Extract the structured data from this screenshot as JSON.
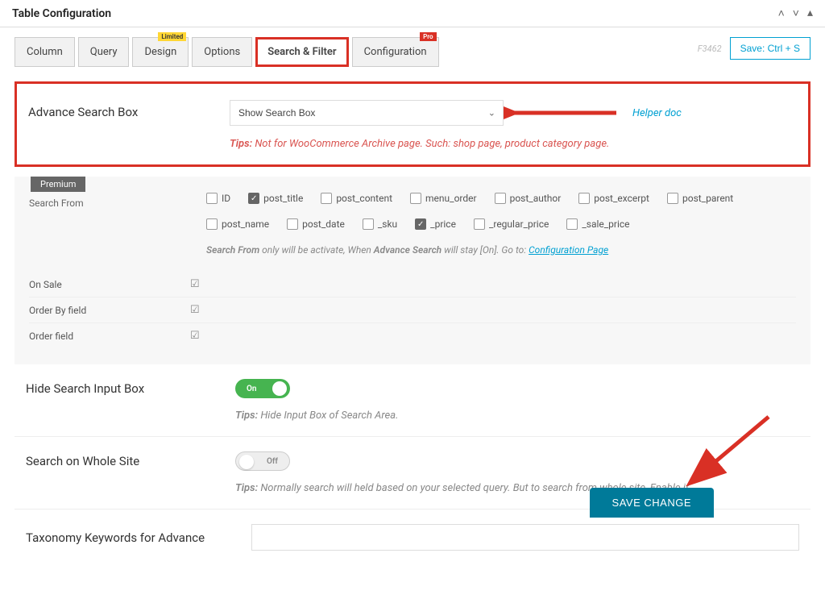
{
  "header": {
    "title": "Table Configuration"
  },
  "topbar": {
    "form_id": "F3462",
    "save_label": "Save: Ctrl + S"
  },
  "tabs": {
    "items": [
      {
        "label": "Column"
      },
      {
        "label": "Query"
      },
      {
        "label": "Design",
        "badge": "Limited",
        "badge_type": "limited"
      },
      {
        "label": "Options"
      },
      {
        "label": "Search & Filter",
        "active": true
      },
      {
        "label": "Configuration",
        "badge": "Pro",
        "badge_type": "pro"
      }
    ]
  },
  "advance_search": {
    "label": "Advance Search Box",
    "selected": "Show Search Box",
    "helper": "Helper doc",
    "tips_label": "Tips:",
    "tips_text": "Not for WooCommerce Archive page. Such: shop page, product category page."
  },
  "premium": {
    "badge": "Premium",
    "search_from_label": "Search From",
    "checkboxes": [
      {
        "label": "ID",
        "checked": false
      },
      {
        "label": "post_title",
        "checked": true
      },
      {
        "label": "post_content",
        "checked": false
      },
      {
        "label": "menu_order",
        "checked": false
      },
      {
        "label": "post_author",
        "checked": false
      },
      {
        "label": "post_excerpt",
        "checked": false
      },
      {
        "label": "post_parent",
        "checked": false
      },
      {
        "label": "post_name",
        "checked": false
      },
      {
        "label": "post_date",
        "checked": false
      },
      {
        "label": "_sku",
        "checked": false
      },
      {
        "label": "_price",
        "checked": true
      },
      {
        "label": "_regular_price",
        "checked": false
      },
      {
        "label": "_sale_price",
        "checked": false
      }
    ],
    "note_1a": "Search From",
    "note_1b": " only will be activate, When ",
    "note_1c": "Advance Search",
    "note_1d": " will stay [On]. Go to: ",
    "note_link": "Configuration Page",
    "sub_rows": [
      {
        "label": "On Sale"
      },
      {
        "label": "Order By field"
      },
      {
        "label": "Order field"
      }
    ]
  },
  "hide_search": {
    "label": "Hide Search Input Box",
    "toggle": "On",
    "tips_label": "Tips:",
    "tips_text": "Hide Input Box of Search Area."
  },
  "whole_site": {
    "label": "Search on Whole Site",
    "toggle": "Off",
    "tips_label": "Tips:",
    "tips_text": "Normally search will held based on your selected query. But to search from whole site, Enable it."
  },
  "taxonomy": {
    "label": "Taxonomy Keywords for Advance"
  },
  "save_change": "SAVE CHANGE"
}
